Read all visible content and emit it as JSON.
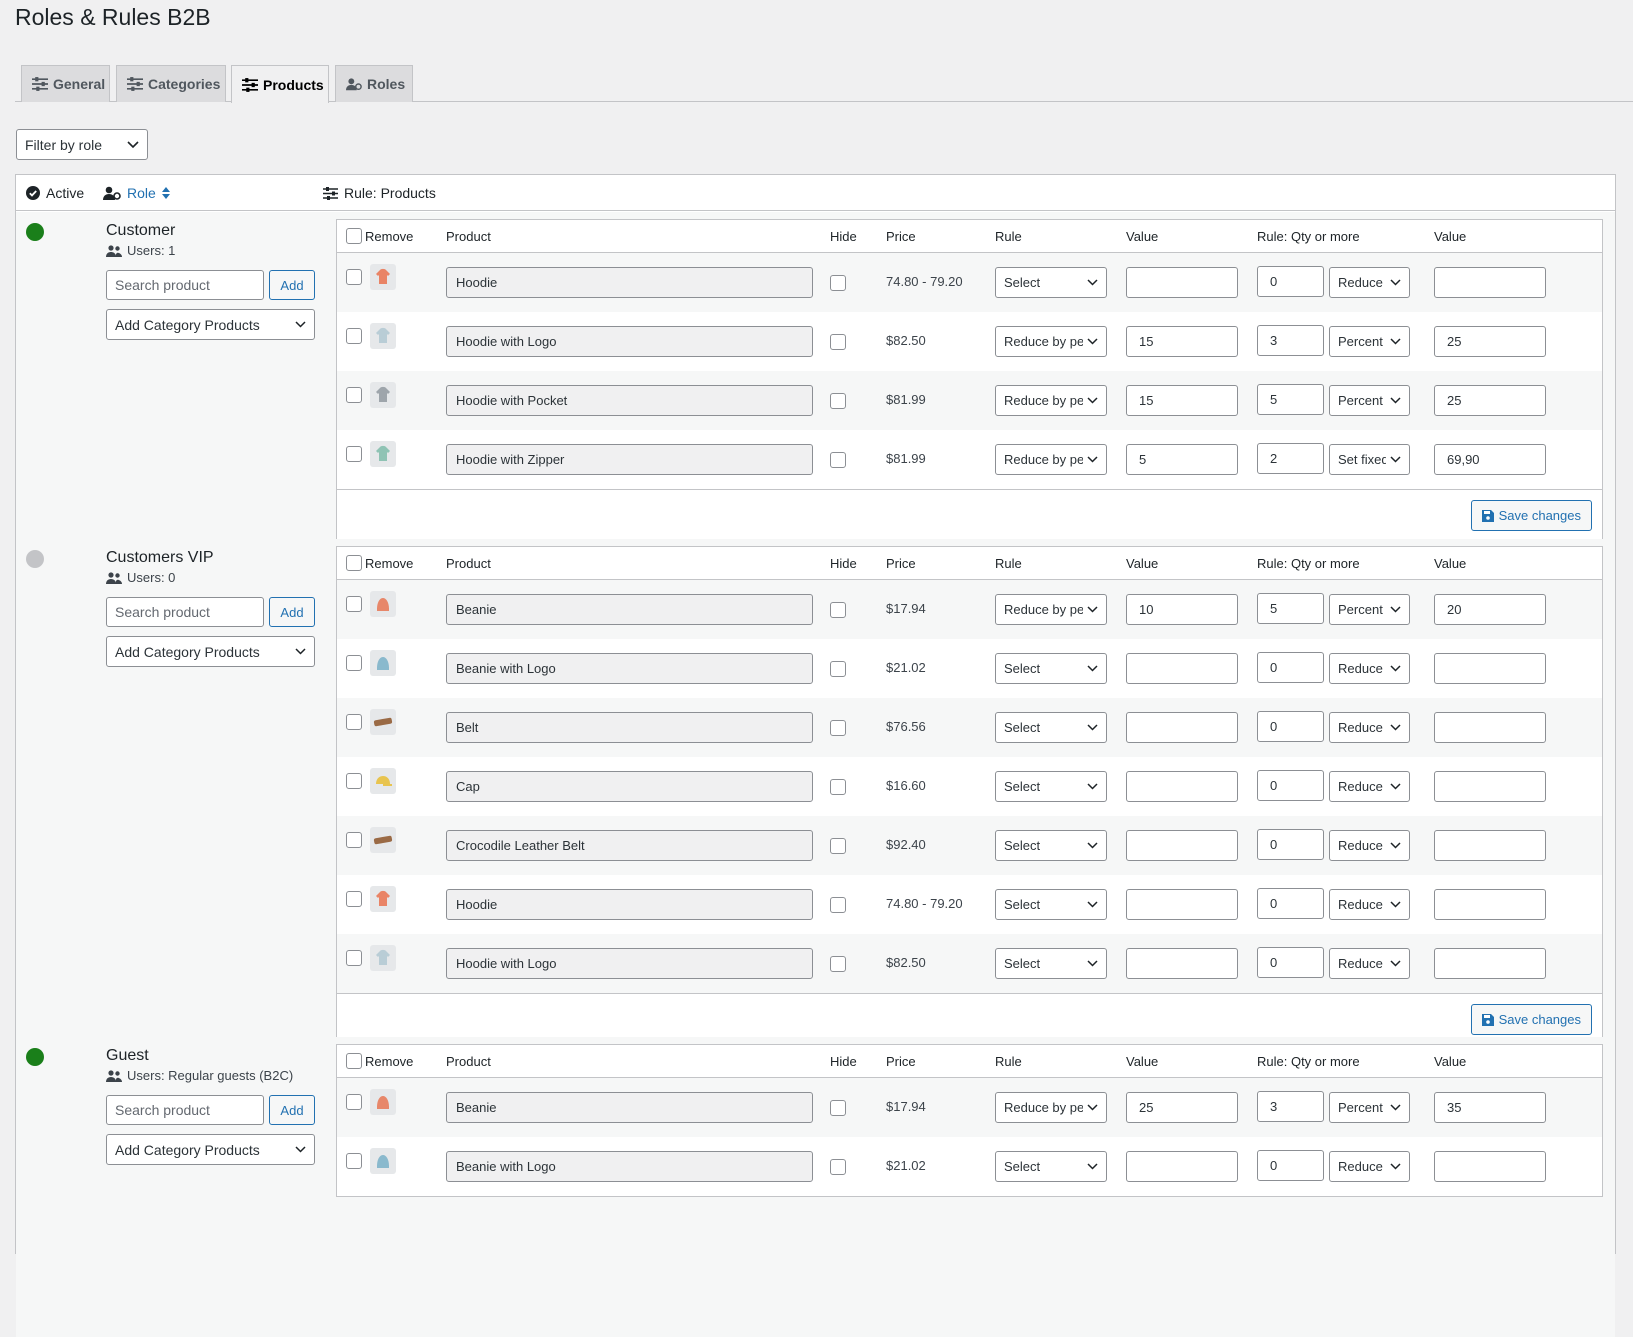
{
  "page": {
    "title": "Roles & Rules B2B"
  },
  "tabs": [
    {
      "label": "General",
      "icon": "sliders-icon",
      "active": false
    },
    {
      "label": "Categories",
      "icon": "sliders-icon",
      "active": false
    },
    {
      "label": "Products",
      "icon": "sliders-icon",
      "active": true
    },
    {
      "label": "Roles",
      "icon": "user-gear-icon",
      "active": false
    }
  ],
  "filter": {
    "label": "Filter by role"
  },
  "columns": {
    "active": "Active",
    "role": "Role",
    "rule": "Rule: Products"
  },
  "table_headers": {
    "remove": "Remove",
    "product": "Product",
    "hide": "Hide",
    "price": "Price",
    "rule": "Rule",
    "value": "Value",
    "qty_rule": "Rule: Qty or more",
    "value2": "Value"
  },
  "labels": {
    "search_placeholder": "Search product",
    "add": "Add",
    "category_select": "Add Category Products",
    "save": "Save changes"
  },
  "colors": {
    "active": "#1a7f1a",
    "inactive": "#c3c4c7",
    "accent": "#2271b1"
  },
  "roles": [
    {
      "name": "Customer",
      "users": "Users: 1",
      "active": true,
      "products": [
        {
          "name": "Hoodie",
          "price": "74.80 - 79.20",
          "rule": "Select",
          "value": "",
          "qty": "0",
          "qty_rule": "Reduce b",
          "value2": "",
          "thumb": "hoodie-orange"
        },
        {
          "name": "Hoodie with Logo",
          "price": "$82.50",
          "rule": "Reduce by per",
          "value": "15",
          "qty": "3",
          "qty_rule": "Percent (",
          "value2": "25",
          "thumb": "hoodie-light"
        },
        {
          "name": "Hoodie with Pocket",
          "price": "$81.99",
          "rule": "Reduce by per",
          "value": "15",
          "qty": "5",
          "qty_rule": "Percent (",
          "value2": "25",
          "thumb": "hoodie-grey"
        },
        {
          "name": "Hoodie with Zipper",
          "price": "$81.99",
          "rule": "Reduce by per",
          "value": "5",
          "qty": "2",
          "qty_rule": "Set fixed",
          "value2": "69,90",
          "thumb": "hoodie-teal"
        }
      ]
    },
    {
      "name": "Customers VIP",
      "users": "Users: 0",
      "active": false,
      "products": [
        {
          "name": "Beanie",
          "price": "$17.94",
          "rule": "Reduce by per",
          "value": "10",
          "qty": "5",
          "qty_rule": "Percent (",
          "value2": "20",
          "thumb": "beanie-orange"
        },
        {
          "name": "Beanie with Logo",
          "price": "$21.02",
          "rule": "Select",
          "value": "",
          "qty": "0",
          "qty_rule": "Reduce b",
          "value2": "",
          "thumb": "beanie-blue"
        },
        {
          "name": "Belt",
          "price": "$76.56",
          "rule": "Select",
          "value": "",
          "qty": "0",
          "qty_rule": "Reduce b",
          "value2": "",
          "thumb": "belt"
        },
        {
          "name": "Cap",
          "price": "$16.60",
          "rule": "Select",
          "value": "",
          "qty": "0",
          "qty_rule": "Reduce b",
          "value2": "",
          "thumb": "cap"
        },
        {
          "name": "Crocodile Leather Belt",
          "price": "$92.40",
          "rule": "Select",
          "value": "",
          "qty": "0",
          "qty_rule": "Reduce b",
          "value2": "",
          "thumb": "belt"
        },
        {
          "name": "Hoodie",
          "price": "74.80 - 79.20",
          "rule": "Select",
          "value": "",
          "qty": "0",
          "qty_rule": "Reduce b",
          "value2": "",
          "thumb": "hoodie-orange"
        },
        {
          "name": "Hoodie with Logo",
          "price": "$82.50",
          "rule": "Select",
          "value": "",
          "qty": "0",
          "qty_rule": "Reduce b",
          "value2": "",
          "thumb": "hoodie-light"
        }
      ]
    },
    {
      "name": "Guest",
      "users": "Users: Regular guests (B2C)",
      "active": true,
      "products": [
        {
          "name": "Beanie",
          "price": "$17.94",
          "rule": "Reduce by per",
          "value": "25",
          "qty": "3",
          "qty_rule": "Percent (",
          "value2": "35",
          "thumb": "beanie-orange"
        },
        {
          "name": "Beanie with Logo",
          "price": "$21.02",
          "rule": "Select",
          "value": "",
          "qty": "0",
          "qty_rule": "Reduce b",
          "value2": "",
          "thumb": "beanie-blue"
        }
      ]
    }
  ]
}
